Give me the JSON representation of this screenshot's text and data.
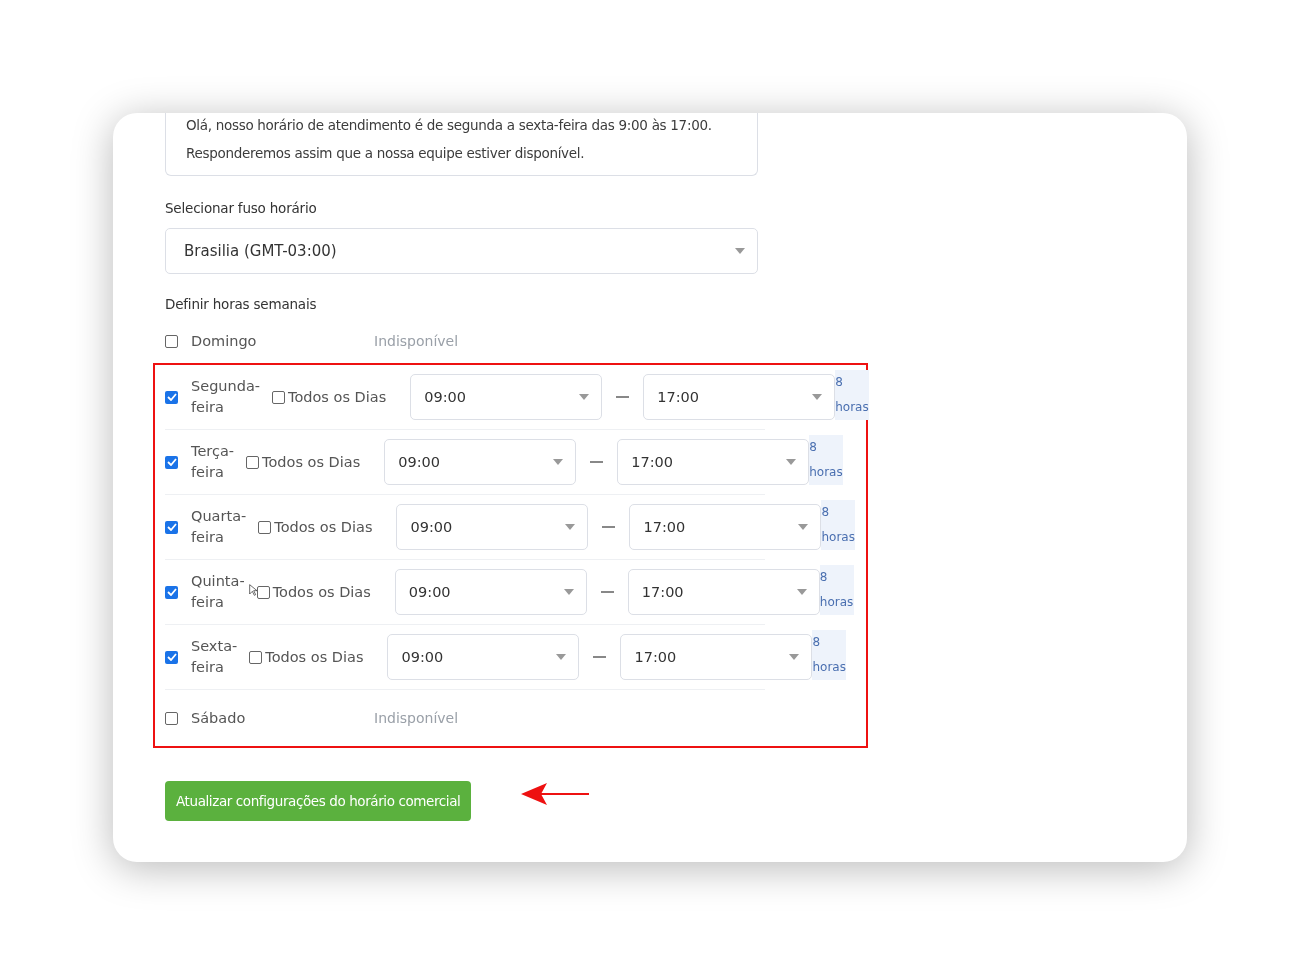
{
  "message": {
    "lines": [
      "Olá, nosso horário de atendimento é de segunda a sexta-feira das 9:00 às 17:00.",
      "Responderemos assim que a nossa equipe estiver disponível."
    ]
  },
  "timezone": {
    "label": "Selecionar fuso horário",
    "value": "Brasilia (GMT-03:00)"
  },
  "weekly_hours": {
    "label": "Definir horas semanais",
    "days": [
      {
        "kind": "unavailable",
        "label": "Domingo",
        "checked": false,
        "status": "Indisponível"
      },
      {
        "kind": "available",
        "label": "Segunda-feira",
        "checked": true,
        "all_days": {
          "label": "Todos os Dias",
          "checked": false
        },
        "start": "09:00",
        "end": "17:00",
        "duration": "8 horas"
      },
      {
        "kind": "available",
        "label": "Terça-feira",
        "checked": true,
        "all_days": {
          "label": "Todos os Dias",
          "checked": false
        },
        "start": "09:00",
        "end": "17:00",
        "duration": "8 horas"
      },
      {
        "kind": "available",
        "label": "Quarta-feira",
        "checked": true,
        "all_days": {
          "label": "Todos os Dias",
          "checked": false
        },
        "start": "09:00",
        "end": "17:00",
        "duration": "8 horas"
      },
      {
        "kind": "available",
        "label": "Quinta-feira",
        "checked": true,
        "all_days": {
          "label": "Todos os Dias",
          "checked": false
        },
        "start": "09:00",
        "end": "17:00",
        "duration": "8 horas"
      },
      {
        "kind": "available",
        "label": "Sexta-feira",
        "checked": true,
        "all_days": {
          "label": "Todos os Dias",
          "checked": false
        },
        "start": "09:00",
        "end": "17:00",
        "duration": "8 horas"
      },
      {
        "kind": "unavailable",
        "label": "Sábado",
        "checked": false,
        "status": "Indisponível"
      }
    ]
  },
  "submit": {
    "label": "Atualizar configurações do horário comercial"
  }
}
